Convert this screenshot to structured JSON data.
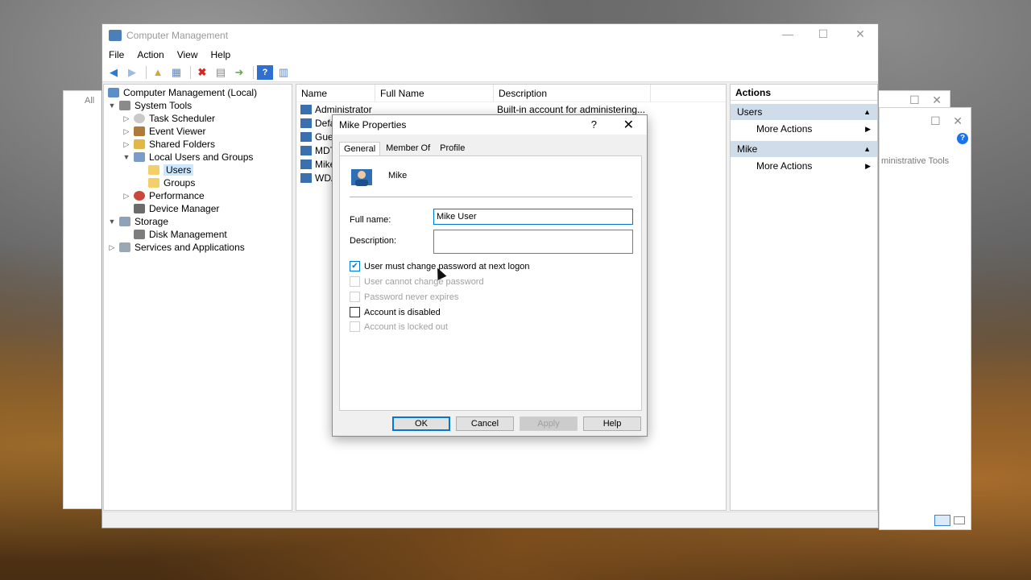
{
  "window": {
    "title": "Computer Management",
    "menu": [
      "File",
      "Action",
      "View",
      "Help"
    ]
  },
  "tree": {
    "root": "Computer Management (Local)",
    "system_tools": "System Tools",
    "task_scheduler": "Task Scheduler",
    "event_viewer": "Event Viewer",
    "shared_folders": "Shared Folders",
    "local_users_groups": "Local Users and Groups",
    "users": "Users",
    "groups": "Groups",
    "performance": "Performance",
    "device_manager": "Device Manager",
    "storage": "Storage",
    "disk_management": "Disk Management",
    "services_apps": "Services and Applications"
  },
  "list": {
    "headers": [
      "Name",
      "Full Name",
      "Description"
    ],
    "rows": [
      {
        "name": "Administrator",
        "full_name": "",
        "description": "Built-in account for administering..."
      },
      {
        "name": "Defa",
        "full_name": "",
        "description": ""
      },
      {
        "name": "Gues",
        "full_name": "",
        "description": ""
      },
      {
        "name": "MDT",
        "full_name": "",
        "description": ""
      },
      {
        "name": "Mike",
        "full_name": "",
        "description": ""
      },
      {
        "name": "WDA",
        "full_name": "",
        "description": ""
      }
    ]
  },
  "actions": {
    "title": "Actions",
    "section1": "Users",
    "more1": "More Actions",
    "section2": "Mike",
    "more2": "More Actions"
  },
  "dialog": {
    "title": "Mike Properties",
    "help_glyph": "?",
    "tabs": [
      "General",
      "Member Of",
      "Profile"
    ],
    "user_name": "Mike",
    "full_name_label": "Full name:",
    "full_name_value": "Mike User",
    "description_label": "Description:",
    "description_value": "",
    "checkboxes": [
      {
        "label": "User must change password at next logon",
        "checked": true,
        "enabled": true
      },
      {
        "label": "User cannot change password",
        "checked": false,
        "enabled": false
      },
      {
        "label": "Password never expires",
        "checked": false,
        "enabled": false
      },
      {
        "label": "Account is disabled",
        "checked": false,
        "enabled": true
      },
      {
        "label": "Account is locked out",
        "checked": false,
        "enabled": false
      }
    ],
    "buttons": {
      "ok": "OK",
      "cancel": "Cancel",
      "apply": "Apply",
      "help": "Help"
    }
  },
  "background_windows": {
    "all_label": "All",
    "admin_tools": "ministrative Tools"
  }
}
